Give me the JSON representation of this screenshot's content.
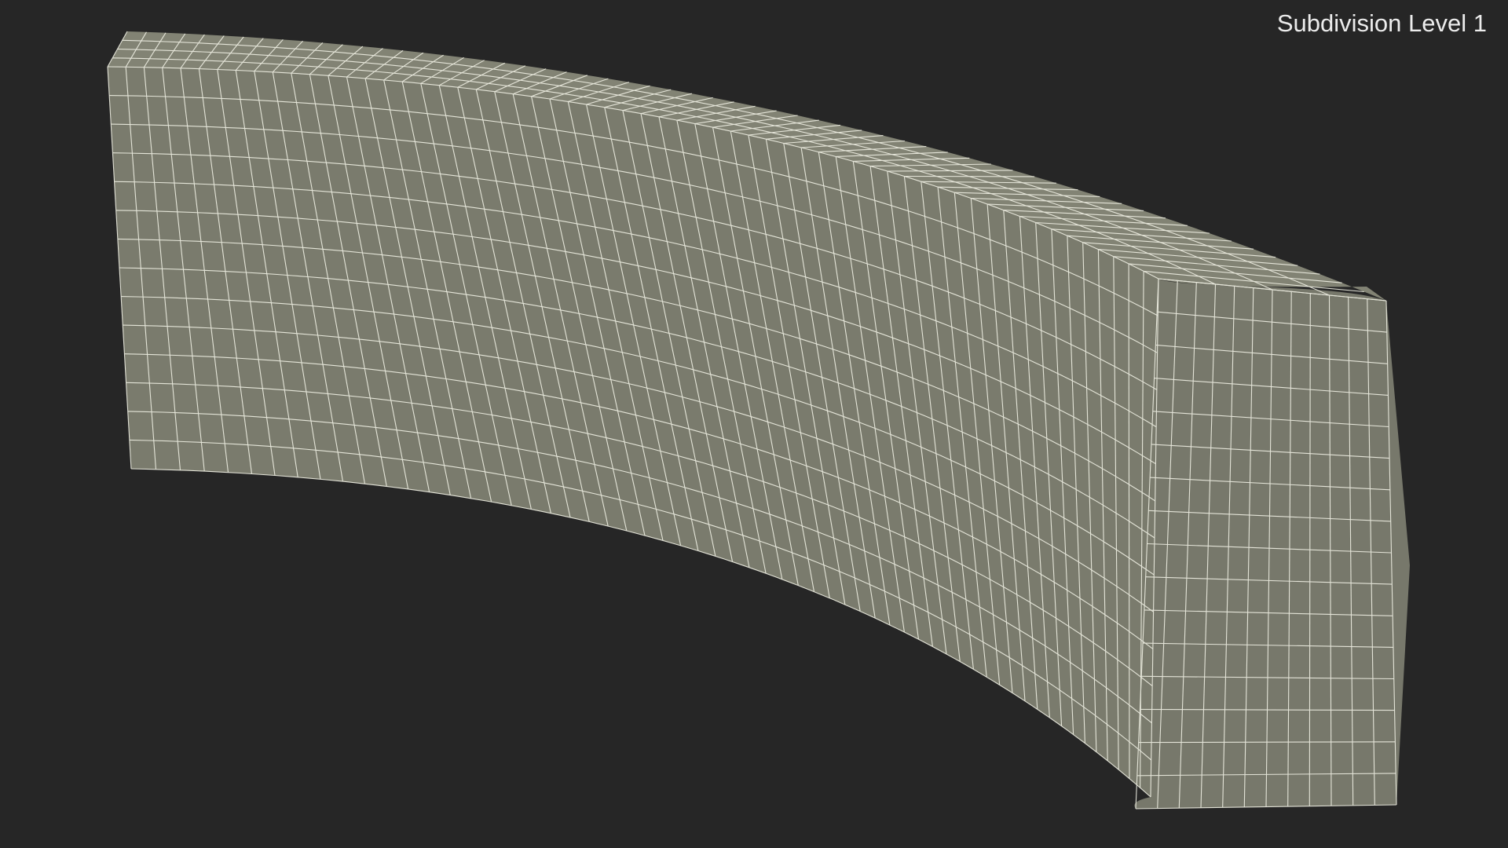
{
  "viewport": {
    "label": "Subdivision Level 1",
    "background_color": "#262626",
    "mesh_fill_color": "#7a7b6d",
    "mesh_side_fill_color": "#75766a",
    "wire_color": "#eeeee2"
  }
}
